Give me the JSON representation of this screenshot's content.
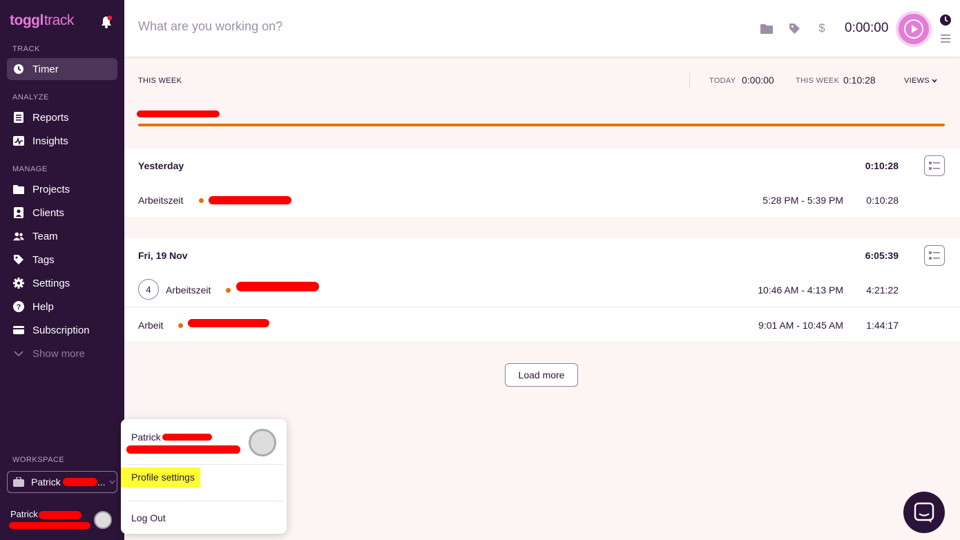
{
  "app": {
    "logo_bold": "toggl",
    "logo_light": "track"
  },
  "sidebar": {
    "sections": {
      "track": "TRACK",
      "analyze": "ANALYZE",
      "manage": "MANAGE",
      "workspace": "WORKSPACE"
    },
    "items": [
      {
        "label": "Timer",
        "icon": "clock-icon"
      },
      {
        "label": "Reports",
        "icon": "reports-icon"
      },
      {
        "label": "Insights",
        "icon": "insights-icon"
      },
      {
        "label": "Projects",
        "icon": "folder-icon"
      },
      {
        "label": "Clients",
        "icon": "client-icon"
      },
      {
        "label": "Team",
        "icon": "team-icon"
      },
      {
        "label": "Tags",
        "icon": "tag-icon"
      },
      {
        "label": "Settings",
        "icon": "gear-icon"
      },
      {
        "label": "Help",
        "icon": "help-icon"
      },
      {
        "label": "Subscription",
        "icon": "card-icon"
      },
      {
        "label": "Show more",
        "icon": "chevron-down-icon"
      }
    ],
    "workspace_name": "Patrick",
    "workspace_ellipsis": "...",
    "user_name": "Patrick"
  },
  "topbar": {
    "placeholder": "What are you working on?",
    "timer": "0:00:00",
    "currency_symbol": "$"
  },
  "summary": {
    "this_week_label": "THIS WEEK",
    "today_label": "TODAY",
    "today_value": "0:00:00",
    "week_label": "THIS WEEK",
    "week_value": "0:10:28",
    "views_label": "VIEWS",
    "progress_color": "#e57300"
  },
  "days": [
    {
      "title": "Yesterday",
      "total": "0:10:28",
      "entries": [
        {
          "description": "Arbeitszeit",
          "range": "5:28 PM - 5:39 PM",
          "duration": "0:10:28"
        }
      ]
    },
    {
      "title": "Fri, 19 Nov",
      "total": "6:05:39",
      "entries": [
        {
          "count": "4",
          "description": "Arbeitszeit",
          "range": "10:46 AM - 4:13 PM",
          "duration": "4:21:22"
        },
        {
          "description": "Arbeit",
          "range": "9:01 AM - 10:45 AM",
          "duration": "1:44:17"
        }
      ]
    }
  ],
  "load_more": "Load more",
  "popup": {
    "name": "Patrick",
    "profile_settings": "Profile settings",
    "log_out": "Log Out"
  },
  "colors": {
    "sidebar": "#2c1338",
    "accent": "#e57cd8",
    "project": "#e57300"
  }
}
